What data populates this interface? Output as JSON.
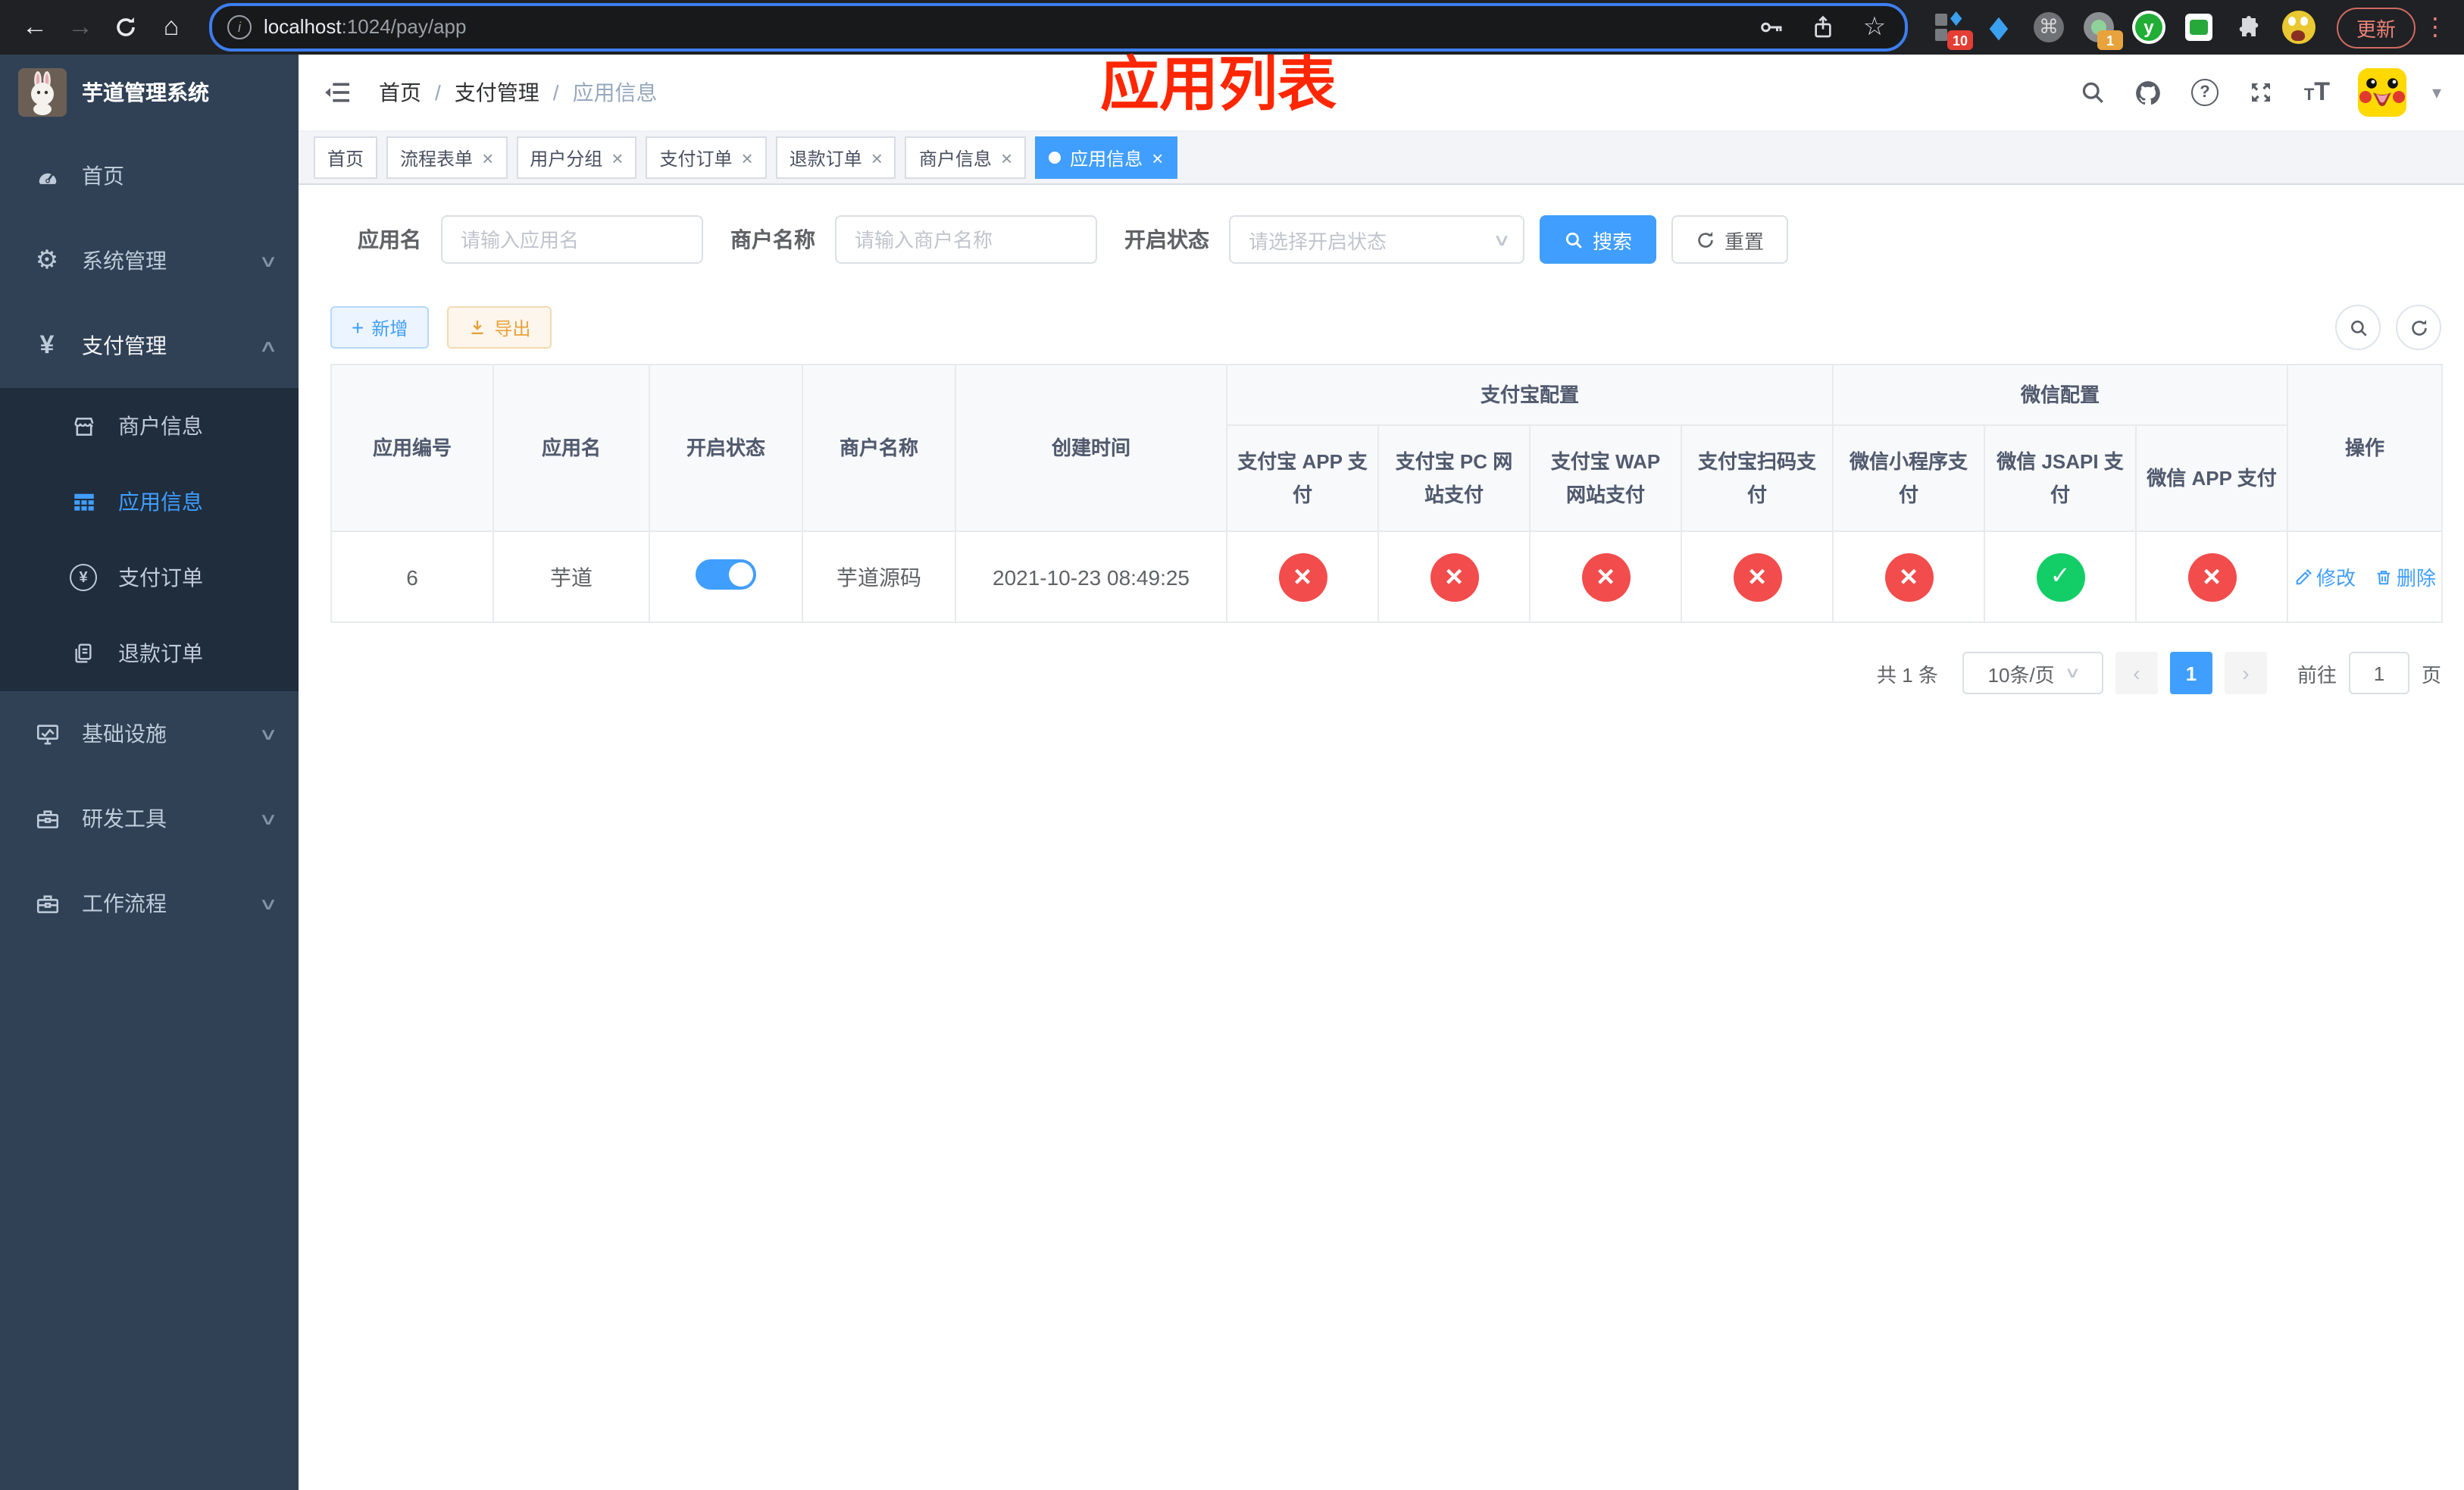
{
  "glyphs": {
    "close": "×",
    "chevron_down": "∨",
    "chevron_up": "∧",
    "back": "←",
    "forward": "→",
    "home": "⌂",
    "dots": "⋮",
    "star": "☆",
    "plus": "+",
    "yen": "¥",
    "gear": "⚙",
    "command": "⌘",
    "gem": "◆",
    "caret_down": "▾",
    "question": "?",
    "info": "i",
    "prev": "‹",
    "next": "›",
    "slash": "/",
    "t_small": "T",
    "t_big": "T"
  },
  "browser": {
    "url_host": "localhost",
    "url_path": ":1024/pay/app",
    "ext_badge_grid": "10",
    "ext_badge_circle": "1",
    "ext_y_label": "y",
    "update_label": "更新"
  },
  "sidebar": {
    "title": "芋道管理系统",
    "home": "首页",
    "system": "系统管理",
    "payment": "支付管理",
    "sub_merchant": "商户信息",
    "sub_app": "应用信息",
    "sub_pay_order": "支付订单",
    "sub_refund_order": "退款订单",
    "infra": "基础设施",
    "dev_tools": "研发工具",
    "workflow": "工作流程"
  },
  "breadcrumb": {
    "items": [
      "首页",
      "支付管理",
      "应用信息"
    ]
  },
  "annotation": "应用列表",
  "tabs": [
    {
      "label": "首页"
    },
    {
      "label": "流程表单"
    },
    {
      "label": "用户分组"
    },
    {
      "label": "支付订单"
    },
    {
      "label": "退款订单"
    },
    {
      "label": "商户信息"
    },
    {
      "label": "应用信息"
    }
  ],
  "filters": {
    "app_name_label": "应用名",
    "app_name_placeholder": "请输入应用名",
    "merchant_label": "商户名称",
    "merchant_placeholder": "请输入商户名称",
    "status_label": "开启状态",
    "status_placeholder": "请选择开启状态",
    "search_label": "搜索",
    "reset_label": "重置"
  },
  "toolbar": {
    "add_label": "新增",
    "export_label": "导出"
  },
  "table": {
    "groups": {
      "alipay": "支付宝配置",
      "wechat": "微信配置"
    },
    "cols": {
      "id": "应用编号",
      "name": "应用名",
      "status": "开启状态",
      "merchant": "商户名称",
      "created": "创建时间",
      "action": "操作"
    },
    "alipay_cols": [
      "支付宝 APP 支付",
      "支付宝 PC 网站支付",
      "支付宝 WAP 网站支付",
      "支付宝扫码支付"
    ],
    "wechat_cols": [
      "微信小程序支付",
      "微信 JSAPI 支付",
      "微信 APP 支付"
    ],
    "row": {
      "id": "6",
      "name": "芋道",
      "toggle_state": "on",
      "merchant": "芋道源码",
      "created": "2021-10-23 08:49:25",
      "channels": [
        {
          "state": "off",
          "glyph": "×"
        },
        {
          "state": "off",
          "glyph": "×"
        },
        {
          "state": "off",
          "glyph": "×"
        },
        {
          "state": "off",
          "glyph": "×"
        },
        {
          "state": "off",
          "glyph": "×"
        },
        {
          "state": "on",
          "glyph": "✓"
        },
        {
          "state": "off",
          "glyph": "×"
        }
      ],
      "edit_label": "修改",
      "delete_label": "删除"
    }
  },
  "pagination": {
    "total": "共 1 条",
    "page_size": "10条/页",
    "page": "1",
    "goto_label": "前往",
    "goto_value": "1",
    "unit_label": "页"
  },
  "colors": {
    "accent": "#409eff",
    "danger": "#f24c4c",
    "success": "#13ce66"
  }
}
